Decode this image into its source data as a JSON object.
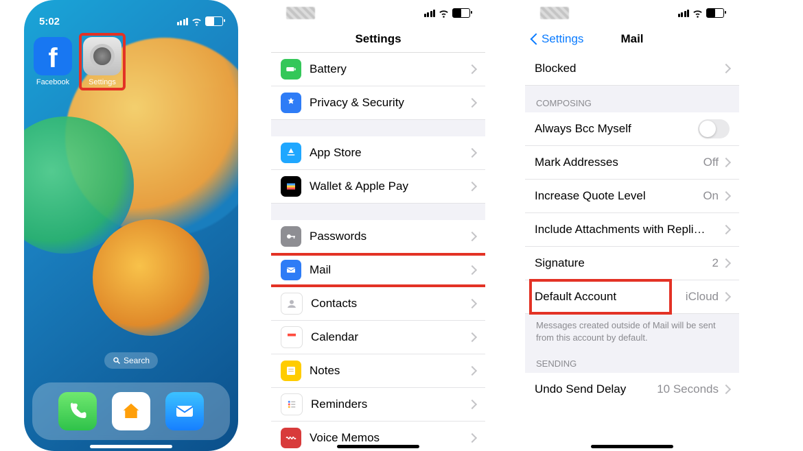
{
  "phone1": {
    "time": "5:02",
    "apps": {
      "facebook": "Facebook",
      "settings": "Settings"
    },
    "search_pill": "Search",
    "dock": [
      "phone",
      "home",
      "mail"
    ]
  },
  "phone2": {
    "title": "Settings",
    "groups": [
      {
        "items": [
          {
            "icon": "battery-icon",
            "color": "ic-green",
            "label": "Battery"
          },
          {
            "icon": "hand-icon",
            "color": "ic-blue",
            "label": "Privacy & Security"
          }
        ]
      },
      {
        "items": [
          {
            "icon": "appstore-icon",
            "color": "ic-lblue",
            "label": "App Store"
          },
          {
            "icon": "wallet-icon",
            "color": "ic-dark",
            "label": "Wallet & Apple Pay"
          }
        ]
      },
      {
        "items": [
          {
            "icon": "key-icon",
            "color": "ic-grey",
            "label": "Passwords"
          },
          {
            "icon": "mail-icon",
            "color": "ic-blue",
            "label": "Mail",
            "highlight": true
          },
          {
            "icon": "contacts-icon",
            "color": "ic-white",
            "label": "Contacts"
          },
          {
            "icon": "calendar-icon",
            "color": "ic-white",
            "label": "Calendar"
          },
          {
            "icon": "notes-icon",
            "color": "ic-yellow",
            "label": "Notes"
          },
          {
            "icon": "reminders-icon",
            "color": "ic-white",
            "label": "Reminders"
          },
          {
            "icon": "voicememos-icon",
            "color": "ic-red",
            "label": "Voice Memos"
          }
        ]
      }
    ]
  },
  "phone3": {
    "back": "Settings",
    "title": "Mail",
    "top_item": {
      "label": "Blocked"
    },
    "composing_header": "Composing",
    "composing_items": [
      {
        "label": "Always Bcc Myself",
        "type": "toggle"
      },
      {
        "label": "Mark Addresses",
        "detail": "Off"
      },
      {
        "label": "Increase Quote Level",
        "detail": "On"
      },
      {
        "label": "Include Attachments with Repli…",
        "detail": ""
      },
      {
        "label": "Signature",
        "detail": "2"
      },
      {
        "label": "Default Account",
        "detail": "iCloud",
        "highlight": true
      }
    ],
    "composing_footer": "Messages created outside of Mail will be sent from this account by default.",
    "sending_header": "Sending",
    "sending_items": [
      {
        "label": "Undo Send Delay",
        "detail": "10 Seconds"
      }
    ]
  }
}
